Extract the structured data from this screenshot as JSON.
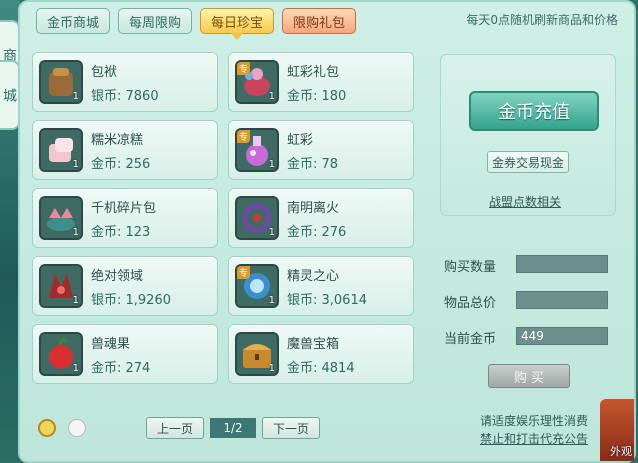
{
  "side_tabs": [
    "商",
    "城"
  ],
  "tabs": [
    {
      "label": "金币商城"
    },
    {
      "label": "每周限购"
    },
    {
      "label": "每日珍宝"
    },
    {
      "label": "限购礼包"
    }
  ],
  "refresh_note": "每天0点随机刷新商品和价格",
  "items": [
    {
      "name": "包袱",
      "price": "银币: 7860",
      "qty": "1",
      "badge": "",
      "icon": "bag-icon",
      "color": "#9a6a3a"
    },
    {
      "name": "虹彩礼包",
      "price": "金币: 180",
      "qty": "1",
      "badge": "专",
      "icon": "rainbow-gift-icon",
      "color": "#c9455e"
    },
    {
      "name": "糯米凉糕",
      "price": "金币: 256",
      "qty": "1",
      "badge": "",
      "icon": "rice-cake-icon",
      "color": "#f3c7cf"
    },
    {
      "name": "虹彩",
      "price": "金币: 78",
      "qty": "1",
      "badge": "专",
      "icon": "potion-icon",
      "color": "#c96ad9"
    },
    {
      "name": "千机碎片包",
      "price": "金币: 123",
      "qty": "1",
      "badge": "",
      "icon": "fragment-pack-icon",
      "color": "#e889a3"
    },
    {
      "name": "南明离火",
      "price": "金币: 276",
      "qty": "1",
      "badge": "",
      "icon": "chain-icon",
      "color": "#6f4aa2"
    },
    {
      "name": "绝对领域",
      "price": "银币: 1,9260",
      "qty": "1",
      "badge": "",
      "icon": "domain-icon",
      "color": "#a02c2c"
    },
    {
      "name": "精灵之心",
      "price": "银币: 3,0614",
      "qty": "1",
      "badge": "专",
      "icon": "spirit-heart-icon",
      "color": "#3a8fd1"
    },
    {
      "name": "兽魂果",
      "price": "金币: 274",
      "qty": "1",
      "badge": "",
      "icon": "fruit-icon",
      "color": "#d9302f"
    },
    {
      "name": "魔兽宝箱",
      "price": "金币: 4814",
      "qty": "1",
      "badge": "",
      "icon": "treasure-chest-icon",
      "color": "#c88a2d"
    }
  ],
  "pager": {
    "prev": "上一页",
    "page": "1/2",
    "next": "下一页"
  },
  "topup": {
    "label": "金币充值"
  },
  "exchange": {
    "label": "金券交易现金"
  },
  "league": {
    "label": "战盟点数相关"
  },
  "form": {
    "qty_label": "购买数量",
    "total_label": "物品总价",
    "gold_label": "当前金币",
    "qty_value": "",
    "total_value": "",
    "gold_value": "449",
    "buy_label": "购 买"
  },
  "notice": {
    "line1": "请适度娱乐理性消费",
    "line2": "禁止和打击代充公告"
  },
  "corner": {
    "label": "外观"
  }
}
